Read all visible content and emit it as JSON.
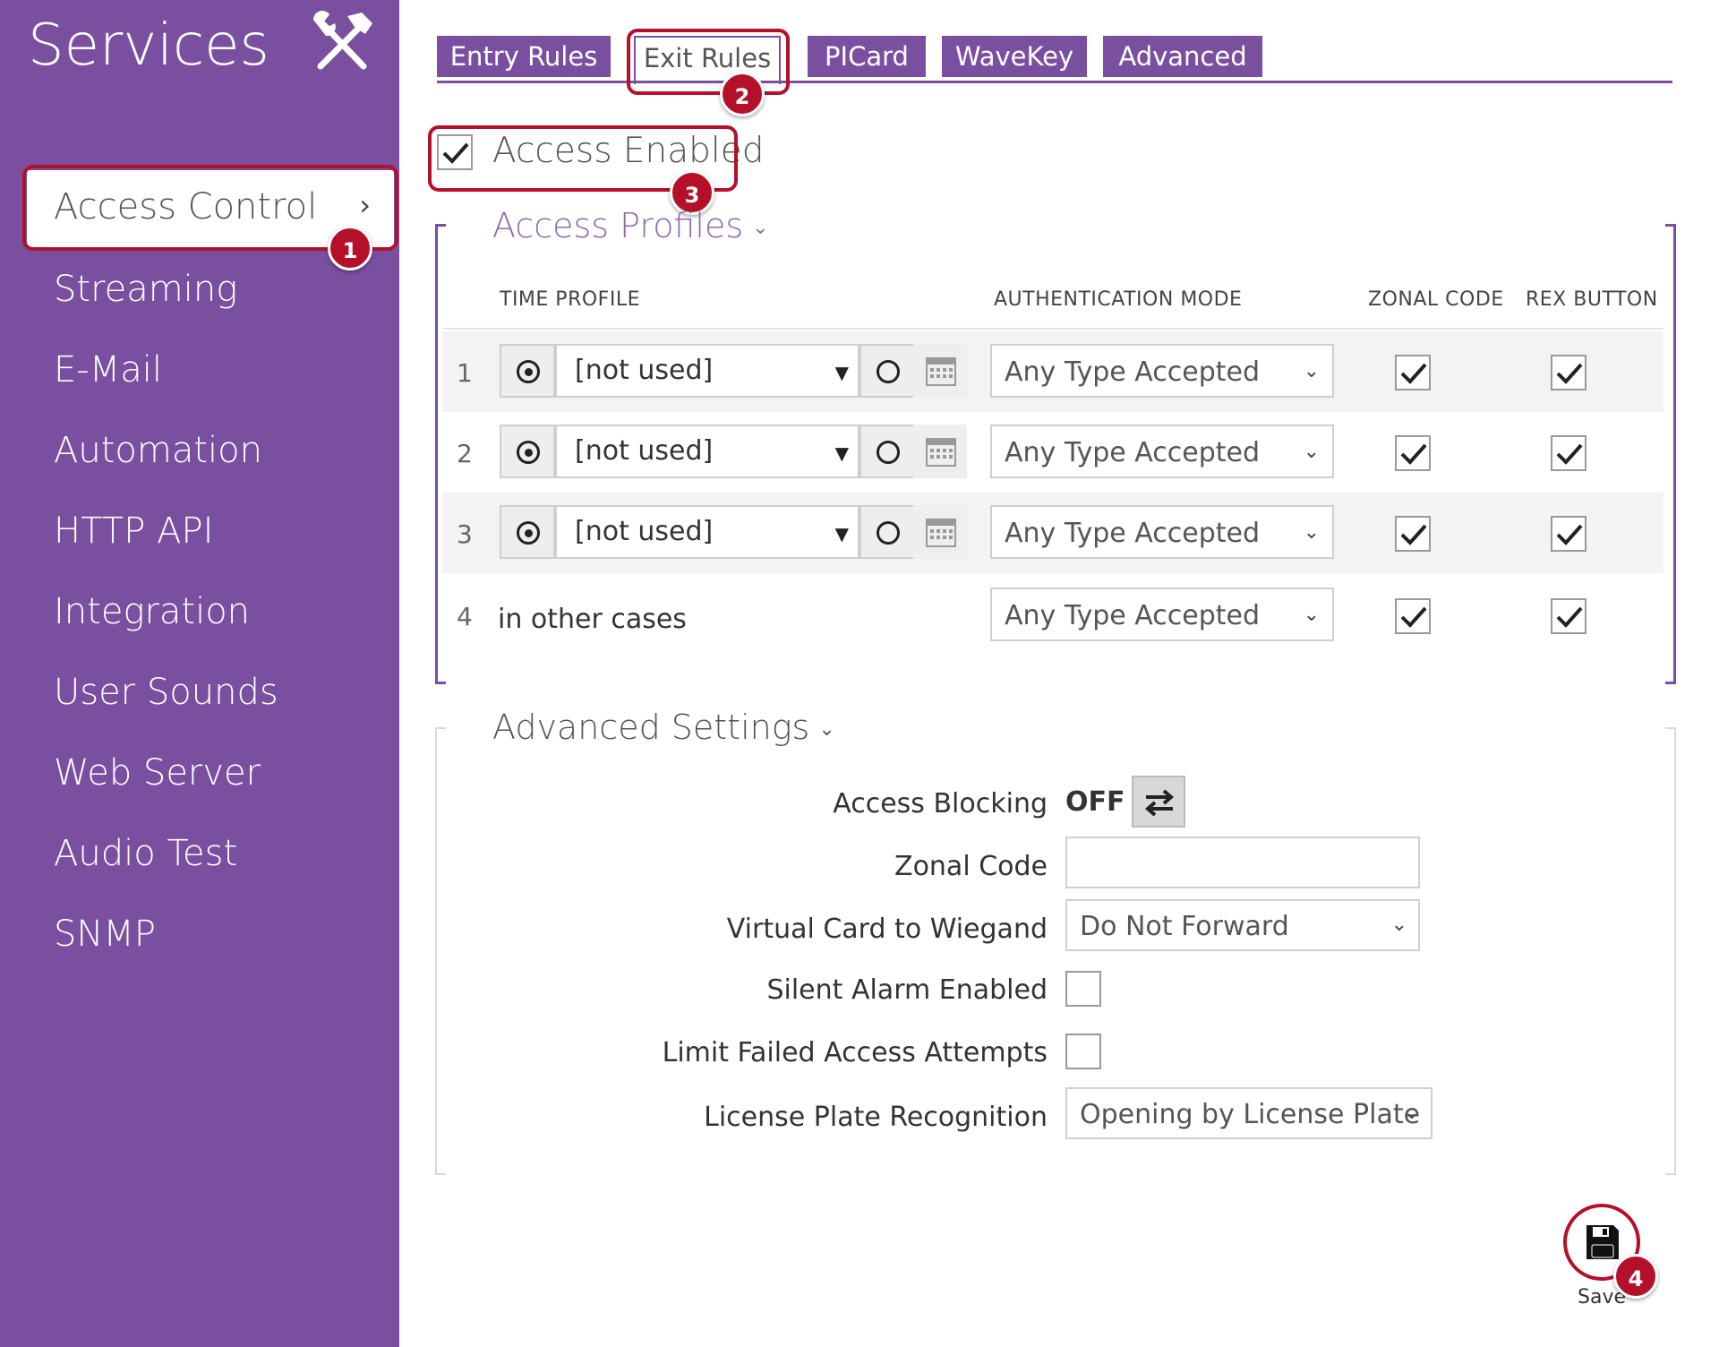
{
  "sidebar": {
    "title": "Services",
    "tools_icon": "hammer-wrench-icon",
    "active_item": "Access Control",
    "items": [
      "Streaming",
      "E-Mail",
      "Automation",
      "HTTP API",
      "Integration",
      "User Sounds",
      "Web Server",
      "Audio Test",
      "SNMP"
    ]
  },
  "tabs": [
    "Entry Rules",
    "Exit Rules",
    "PICard",
    "WaveKey",
    "Advanced"
  ],
  "active_tab": "Exit Rules",
  "access_enabled": {
    "label": "Access Enabled",
    "checked": true
  },
  "access_profiles": {
    "title": "Access Profiles",
    "headers": {
      "time_profile": "TIME PROFILE",
      "auth_mode": "AUTHENTICATION MODE",
      "zonal_code": "ZONAL CODE",
      "rex_button": "REX BUTTON"
    },
    "rows": [
      {
        "num": "1",
        "time_profile": "[not used]",
        "auth_mode": "Any Type Accepted",
        "zonal_code": true,
        "rex_button": true
      },
      {
        "num": "2",
        "time_profile": "[not used]",
        "auth_mode": "Any Type Accepted",
        "zonal_code": true,
        "rex_button": true
      },
      {
        "num": "3",
        "time_profile": "[not used]",
        "auth_mode": "Any Type Accepted",
        "zonal_code": true,
        "rex_button": true
      },
      {
        "num": "4",
        "other_cases": "in other cases",
        "auth_mode": "Any Type Accepted",
        "zonal_code": true,
        "rex_button": true
      }
    ]
  },
  "advanced": {
    "title": "Advanced Settings",
    "access_blocking": {
      "label": "Access Blocking",
      "value": "OFF"
    },
    "zonal_code": {
      "label": "Zonal Code",
      "value": ""
    },
    "virtual_card": {
      "label": "Virtual Card to Wiegand",
      "value": "Do Not Forward"
    },
    "silent_alarm": {
      "label": "Silent Alarm Enabled",
      "checked": false
    },
    "limit_failed": {
      "label": "Limit Failed Access Attempts",
      "checked": false
    },
    "license_plate": {
      "label": "License Plate Recognition",
      "value": "Opening by License Plate"
    }
  },
  "save": {
    "label": "Save"
  },
  "callouts": [
    "1",
    "2",
    "3",
    "4"
  ],
  "colors": {
    "accent": "#7b4fa0",
    "callout": "#b5102a"
  }
}
